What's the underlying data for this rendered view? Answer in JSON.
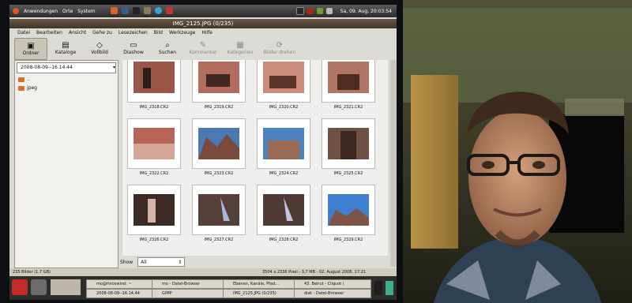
{
  "top_panel": {
    "menus": [
      "Anwendungen",
      "Orte",
      "System"
    ],
    "clock": "Sa, 09. Aug, 20:03:54"
  },
  "window": {
    "title": "IMG_2125.JPG (0/235)",
    "menu": [
      "Datei",
      "Bearbeiten",
      "Ansicht",
      "Gehe zu",
      "Lesezeichen",
      "Bild",
      "Werkzeuge",
      "Hilfe"
    ],
    "toolbar": [
      "Ordner",
      "Kataloge",
      "Vollbild",
      "Diashow",
      "Suchen",
      "Kommentar",
      "Kategorien",
      "Bilder drehen"
    ],
    "toolbar_icons": [
      "folder-icon",
      "catalog-icon",
      "fullscreen-icon",
      "slideshow-icon",
      "search-icon",
      "comment-icon",
      "categories-icon",
      "rotate-icon"
    ]
  },
  "sidebar": {
    "path": "2008-08-09--16.14.44",
    "items": [
      "..",
      "jpeg"
    ]
  },
  "gallery": {
    "rows": [
      [
        "IMG_2318.CR2",
        "IMG_2319.CR2",
        "IMG_2320.CR2",
        "IMG_2321.CR2"
      ],
      [
        "IMG_2322.CR2",
        "IMG_2323.CR2",
        "IMG_2324.CR2",
        "IMG_2325.CR2"
      ],
      [
        "IMG_2326.CR2",
        "IMG_2327.CR2",
        "IMG_2328.CR2",
        "IMG_2329.CR2"
      ]
    ],
    "show_label": "Show",
    "show_value": "All"
  },
  "status": {
    "left": "235 Bilder (1,7 GB)",
    "right": "3504 x 2336 Pixel - 3,7 MB - 02. August 2008, 17:21"
  },
  "taskbar": {
    "row1": [
      "mo@rincewind: ~",
      "mo - Datei-Browser",
      "Ebenen, Kanäle, Pfad...",
      "43. Beirut - Cliquot ("
    ],
    "row2": [
      "2008-08-09--16.14.44",
      "GIMP",
      "IMG_2125.JPG (0/235)",
      "disk - Datei-Browser"
    ]
  }
}
